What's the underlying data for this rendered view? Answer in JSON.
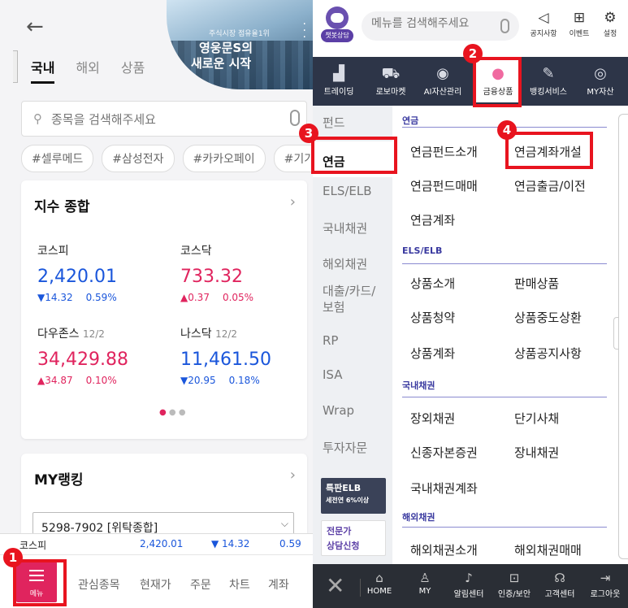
{
  "left": {
    "tabs": [
      "국내",
      "해외",
      "상품"
    ],
    "banner": {
      "line1": "주식시장 점유율1위",
      "line2": "영웅문S의",
      "line3": "새로운 시작"
    },
    "search_placeholder": "종목을 검색해주세요",
    "tags": [
      "#셀루메드",
      "#삼성전자",
      "#카카오페이",
      "#기가레인"
    ],
    "index_card": {
      "title": "지수 종합",
      "items": [
        {
          "name": "코스피",
          "date": "",
          "value": "2,420.01",
          "change": "▼14.32",
          "pct": "0.59%",
          "dir": "down"
        },
        {
          "name": "코스닥",
          "date": "",
          "value": "733.32",
          "change": "▲0.37",
          "pct": "0.05%",
          "dir": "up"
        },
        {
          "name": "다우존스",
          "date": "12/2",
          "value": "34,429.88",
          "change": "▲34.87",
          "pct": "0.10%",
          "dir": "up"
        },
        {
          "name": "나스닥",
          "date": "12/2",
          "value": "11,461.50",
          "change": "▼20.95",
          "pct": "0.18%",
          "dir": "down"
        }
      ]
    },
    "ranking_card": {
      "title": "MY랭킹",
      "account": "5298-7902 [위탁종합]"
    },
    "ticker": {
      "name": "코스피",
      "value": "2,420.01",
      "change": "▼ 14.32",
      "pct": "0.59"
    },
    "bottom_nav": {
      "menu": "메뉴",
      "items": [
        "관심종목",
        "현재가",
        "주문",
        "차트",
        "계좌"
      ]
    }
  },
  "right": {
    "logo_label": "챗봇상담",
    "search_placeholder": "메뉴를 검색해주세요",
    "top_icons": [
      "공지사항",
      "이벤트",
      "설정"
    ],
    "categories": [
      "트레이딩",
      "로보마켓",
      "AI자산관리",
      "금융상품",
      "뱅킹서비스",
      "MY자산"
    ],
    "side_items": [
      "펀드",
      "연금",
      "ELS/ELB",
      "국내채권",
      "해외채권",
      "대출/카드/보험",
      "RP",
      "ISA",
      "Wrap",
      "투자자문"
    ],
    "ads": [
      {
        "title": "특판ELB",
        "sub": "세전연 6%이상"
      },
      {
        "title": "전문가",
        "sub": "상담신청"
      }
    ],
    "sections": [
      {
        "title": "연금",
        "links": [
          "연금펀드소개",
          "연금계좌개설",
          "연금펀드매매",
          "연금출금/이전",
          "연금계좌"
        ]
      },
      {
        "title": "ELS/ELB",
        "links": [
          "상품소개",
          "판매상품",
          "상품청약",
          "상품중도상환",
          "상품계좌",
          "상품공지사항"
        ]
      },
      {
        "title": "국내채권",
        "links": [
          "장외채권",
          "단기사채",
          "신종자본증권",
          "장내채권",
          "국내채권계좌"
        ]
      },
      {
        "title": "해외채권",
        "links": [
          "해외채권소개",
          "해외채권매매"
        ]
      }
    ],
    "bottom_bar": [
      "HOME",
      "MY",
      "알림센터",
      "인증/보안",
      "고객센터",
      "로그아웃"
    ]
  },
  "annotations": [
    "1",
    "2",
    "3",
    "4"
  ],
  "colors": {
    "accent_red": "#e0245e",
    "highlight": "#e8141f",
    "navy": "#2d3548",
    "up": "#e0245e",
    "down": "#1a56db"
  }
}
